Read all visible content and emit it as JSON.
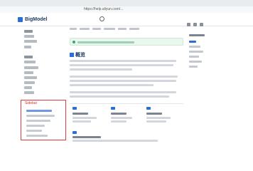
{
  "browser": {
    "url": "https://help.aliyun.com/..."
  },
  "site": {
    "logo_text": "BigModel",
    "search_label": "Q"
  },
  "sidebar": {
    "highlight_title": "Sidebar"
  },
  "content": {
    "page_title": "概览"
  },
  "colors": {
    "accent": "#2b6fd6",
    "highlight_border": "#e53935",
    "notice_bg": "#eaf7ef"
  }
}
